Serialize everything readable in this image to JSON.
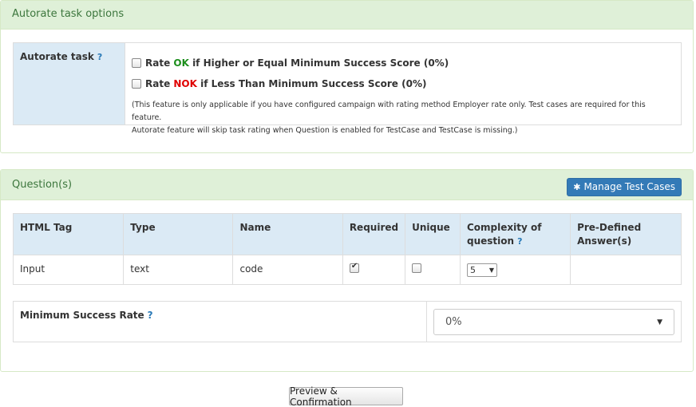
{
  "autorate_panel": {
    "title": "Autorate task options",
    "label": "Autorate task",
    "help": "?",
    "options": [
      {
        "prefix": "Rate ",
        "keyword": "OK",
        "suffix": " if Higher or Equal Minimum Success Score (0%)",
        "checked": false
      },
      {
        "prefix": "Rate ",
        "keyword": "NOK",
        "suffix": " if Less Than Minimum Success Score (0%)",
        "checked": false
      }
    ],
    "note_line1": "(This feature is only applicable if you have configured campaign with rating method Employer rate only. Test cases are required for this feature.",
    "note_line2": "Autorate feature will skip task rating when Question is enabled for TestCase and TestCase is missing.)",
    "ok_color": "#1d8f1d",
    "nok_color": "#e00000"
  },
  "questions_panel": {
    "title": "Question(s)",
    "manage_button": "Manage Test Cases",
    "columns": [
      "HTML Tag",
      "Type",
      "Name",
      "Required",
      "Unique",
      "Complexity of question",
      "Pre-Defined Answer(s)"
    ],
    "complexity_col_prefix": "Complexity of",
    "complexity_col_suffix": "question",
    "help": "?",
    "rows": [
      {
        "html_tag": "Input",
        "type": "text",
        "name": "code",
        "required": true,
        "unique": false,
        "complexity": "5",
        "predefined": ""
      }
    ],
    "min_success_label": "Minimum Success Rate",
    "min_success_value": "0%"
  },
  "preview_button": "Preview & Confirmation"
}
